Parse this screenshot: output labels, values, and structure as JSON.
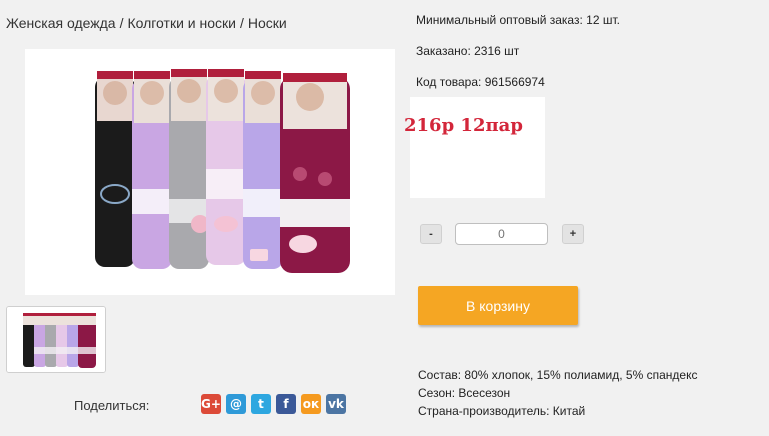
{
  "breadcrumb": {
    "items": [
      "Женская одежда",
      "Колготки и носки",
      "Носки"
    ],
    "separator": "/"
  },
  "product": {
    "min_order": "Минимальный оптовый заказ: 12 шт.",
    "ordered": "Заказано: 2316 шт",
    "code": "Код товара: 961566974",
    "promo": "216р 12пар",
    "quantity_placeholder": "0"
  },
  "cart": {
    "minus_label": "-",
    "plus_label": "+",
    "add_label": "В корзину"
  },
  "specs": {
    "composition": "Состав: 80% хлопок, 15% полиамид, 5% спандекс",
    "season": "Сезон: Всесезон",
    "country": "Страна-производитель: Китай"
  },
  "share": {
    "label": "Поделиться:",
    "buttons": [
      {
        "icon": "google-plus-icon",
        "glyph": "G+",
        "color": "#dc4a38"
      },
      {
        "icon": "email-icon",
        "glyph": "@",
        "color": "#2f9ad8"
      },
      {
        "icon": "twitter-icon",
        "glyph": "t",
        "color": "#2ea7e0"
      },
      {
        "icon": "facebook-icon",
        "glyph": "f",
        "color": "#3b5998"
      },
      {
        "icon": "odnoklassniki-icon",
        "glyph": "ок",
        "color": "#f59a1f"
      },
      {
        "icon": "vk-icon",
        "glyph": "vk",
        "color": "#4c75a3"
      }
    ]
  },
  "colors": {
    "accent_button": "#f5a623",
    "promo_text": "#d3263a"
  }
}
